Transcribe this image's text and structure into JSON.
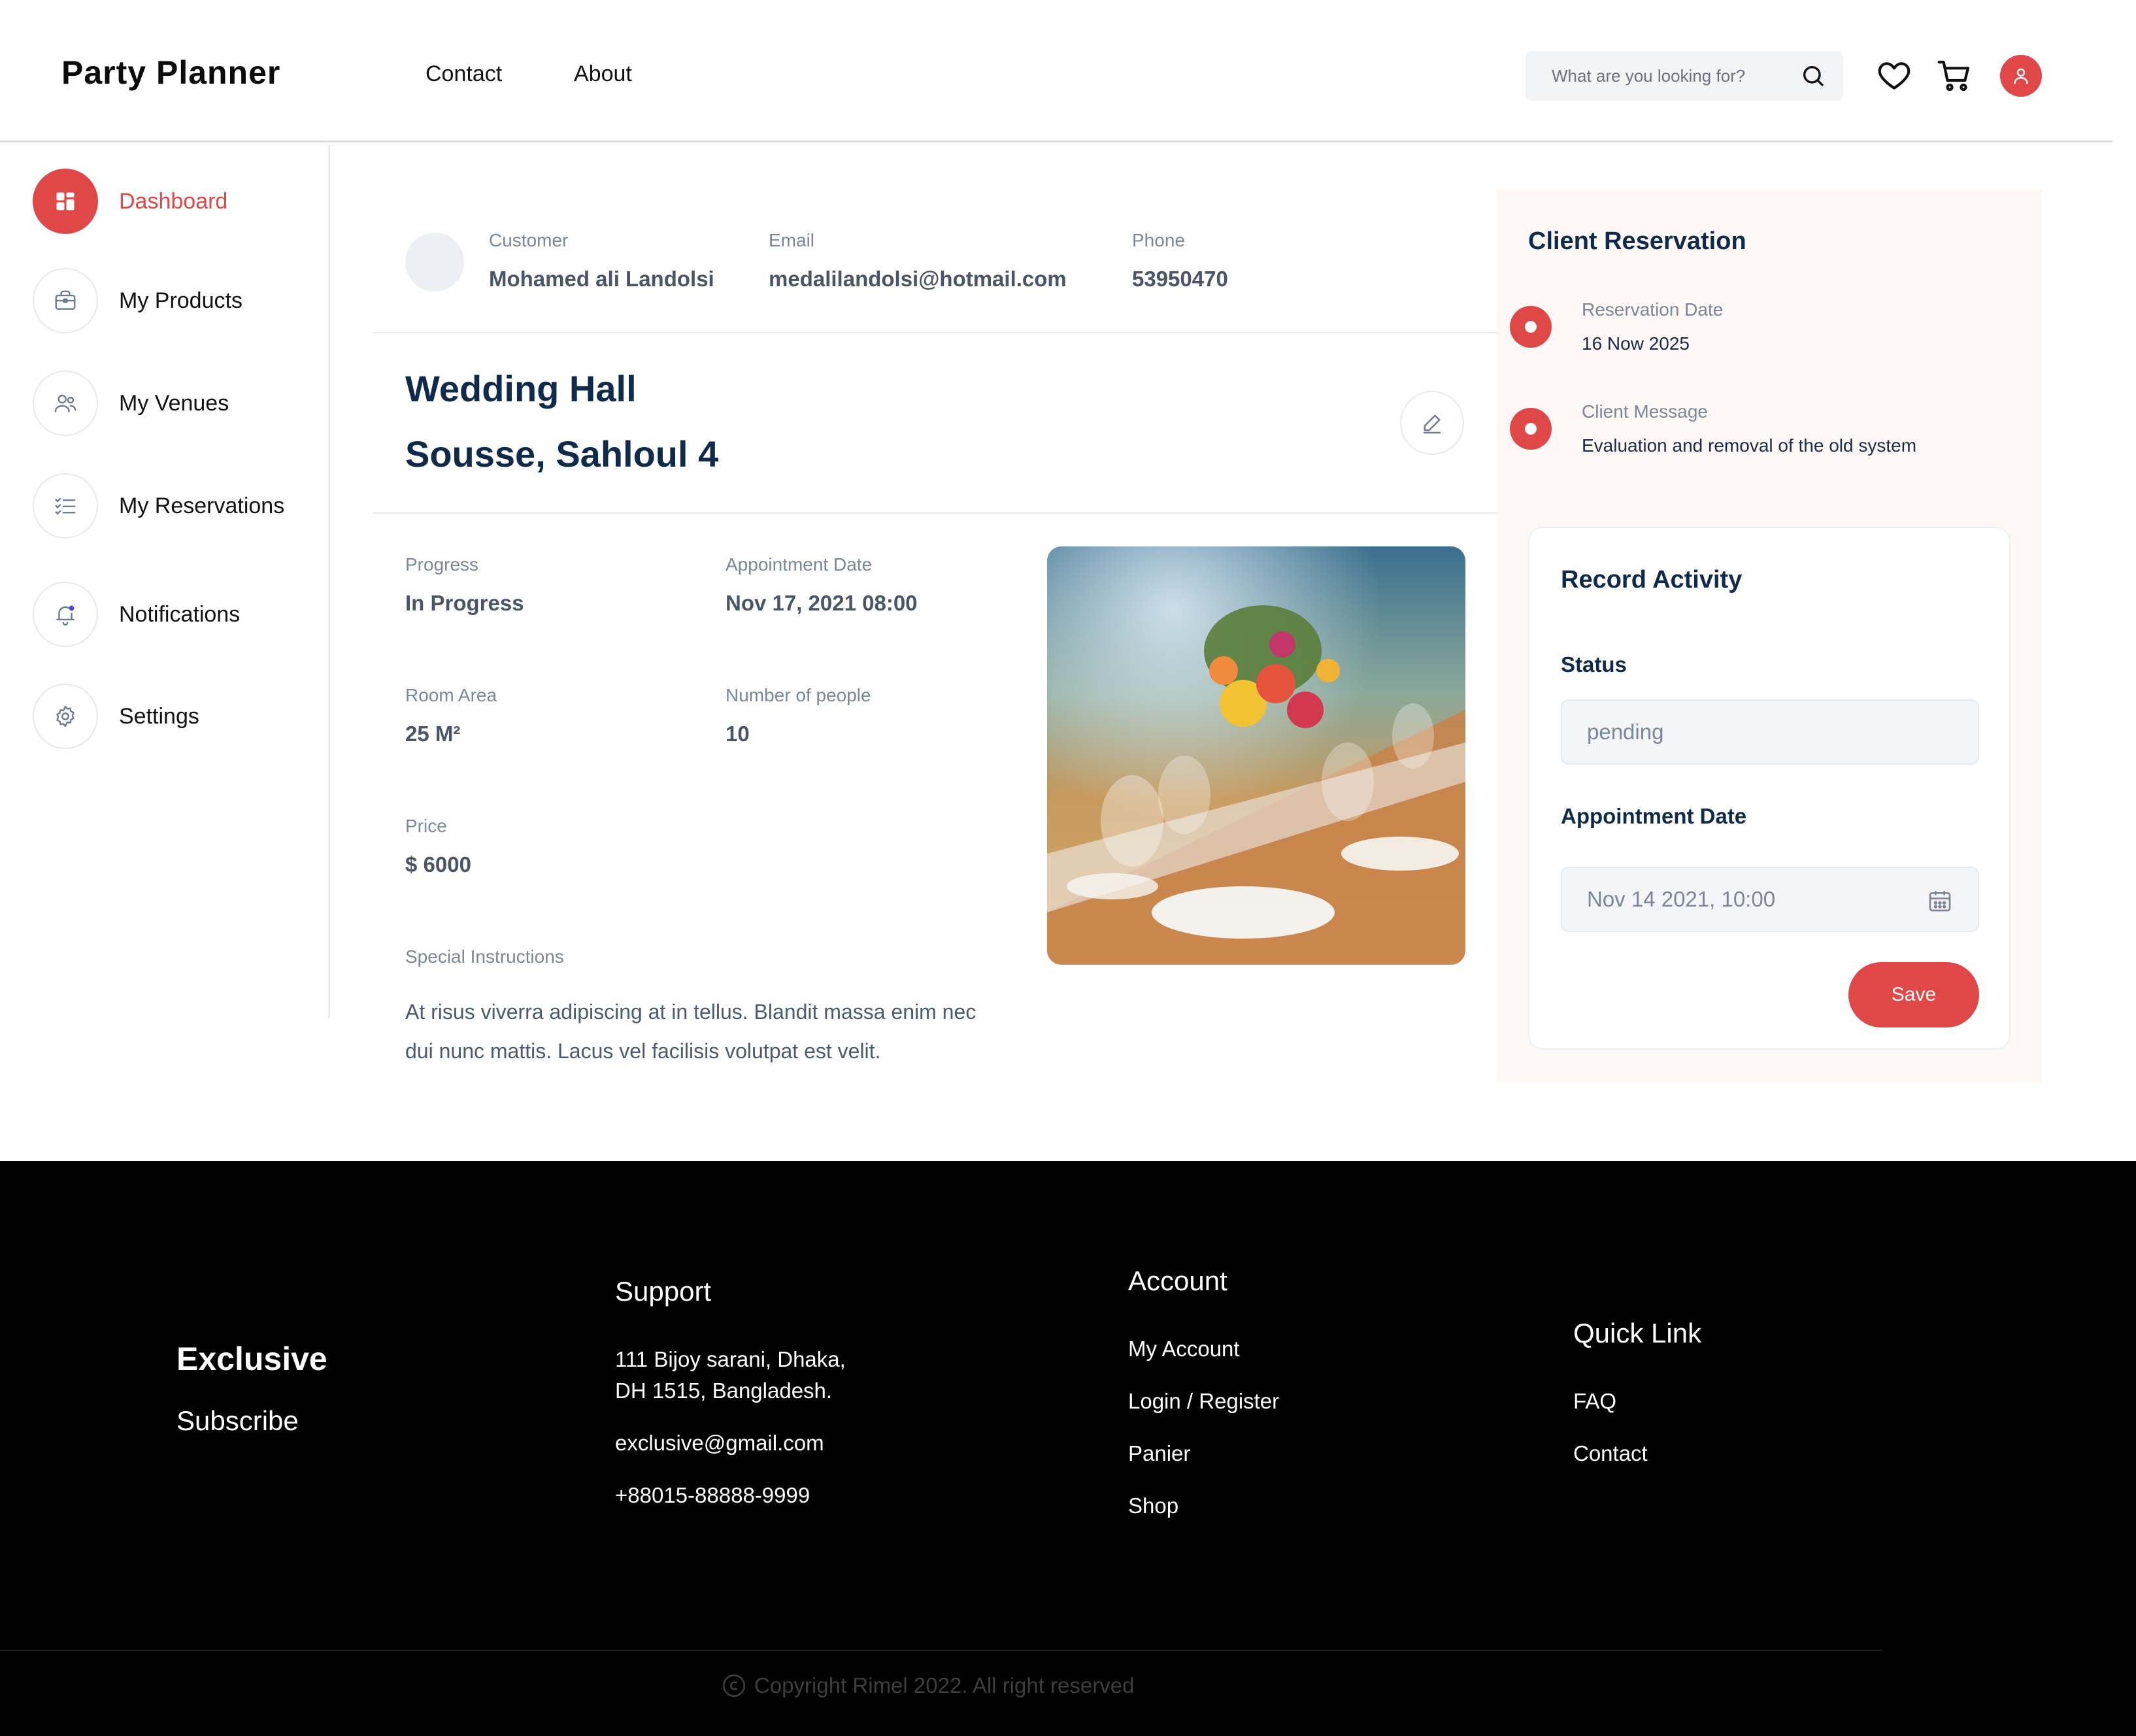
{
  "header": {
    "brand": "Party Planner",
    "nav": [
      "Contact",
      "About"
    ],
    "search_placeholder": "What are you looking for?",
    "icons": [
      "search-icon",
      "heart-icon",
      "cart-icon",
      "user-icon"
    ]
  },
  "sidebar": {
    "items": [
      {
        "label": "Dashboard",
        "icon": "dashboard-icon",
        "active": true
      },
      {
        "label": "My Products",
        "icon": "briefcase-icon"
      },
      {
        "label": "My Venues",
        "icon": "users-icon"
      },
      {
        "label": "My Reservations",
        "icon": "checklist-icon"
      },
      {
        "label": "Notifications",
        "icon": "bell-icon"
      },
      {
        "label": "Settings",
        "icon": "gear-icon"
      }
    ]
  },
  "customer": {
    "customer_label": "Customer",
    "customer_name": "Mohamed ali Landolsi",
    "email_label": "Email",
    "email": "medalilandolsi@hotmail.com",
    "phone_label": "Phone",
    "phone": "53950470"
  },
  "venue": {
    "title_line1": "Wedding Hall",
    "title_line2": "Sousse, Sahloul 4",
    "progress_label": "Progress",
    "progress": "In Progress",
    "appointment_label": "Appointment Date",
    "appointment": "Nov 17, 2021 08:00",
    "room_area_label": "Room Area",
    "room_area": "25 M²",
    "people_label": "Number of people",
    "people": "10",
    "price_label": "Price",
    "price": "$ 6000",
    "instructions_label": "Special Instructions",
    "instructions": "At risus viverra adipiscing at in tellus. Blandit massa enim nec dui nunc mattis. Lacus vel facilisis volutpat est velit."
  },
  "reservation": {
    "title": "Client Reservation",
    "date_label": "Reservation Date",
    "date": "16 Now 2025",
    "message_label": "Client Message",
    "message": "Evaluation and removal of the old system"
  },
  "record": {
    "title": "Record Activity",
    "status_label": "Status",
    "status_value": "pending",
    "date_label": "Appointment Date",
    "date_value": "Nov 14 2021, 10:00",
    "save_label": "Save"
  },
  "footer": {
    "brand": "Exclusive",
    "subscribe": "Subscribe",
    "support_title": "Support",
    "address_line1": "111 Bijoy sarani, Dhaka,",
    "address_line2": "DH 1515, Bangladesh.",
    "email": "exclusive@gmail.com",
    "phone": "+88015-88888-9999",
    "account_title": "Account",
    "account_links": [
      "My Account",
      "Login / Register",
      "Panier",
      "Shop"
    ],
    "quick_title": "Quick Link",
    "quick_links": [
      "FAQ",
      "Contact"
    ],
    "copyright": "Copyright Rimel 2022. All right reserved"
  },
  "colors": {
    "accent": "#e04848",
    "navy": "#0f2a4a",
    "panel_bg": "#fdf7f6",
    "footer_bg": "#000000"
  }
}
